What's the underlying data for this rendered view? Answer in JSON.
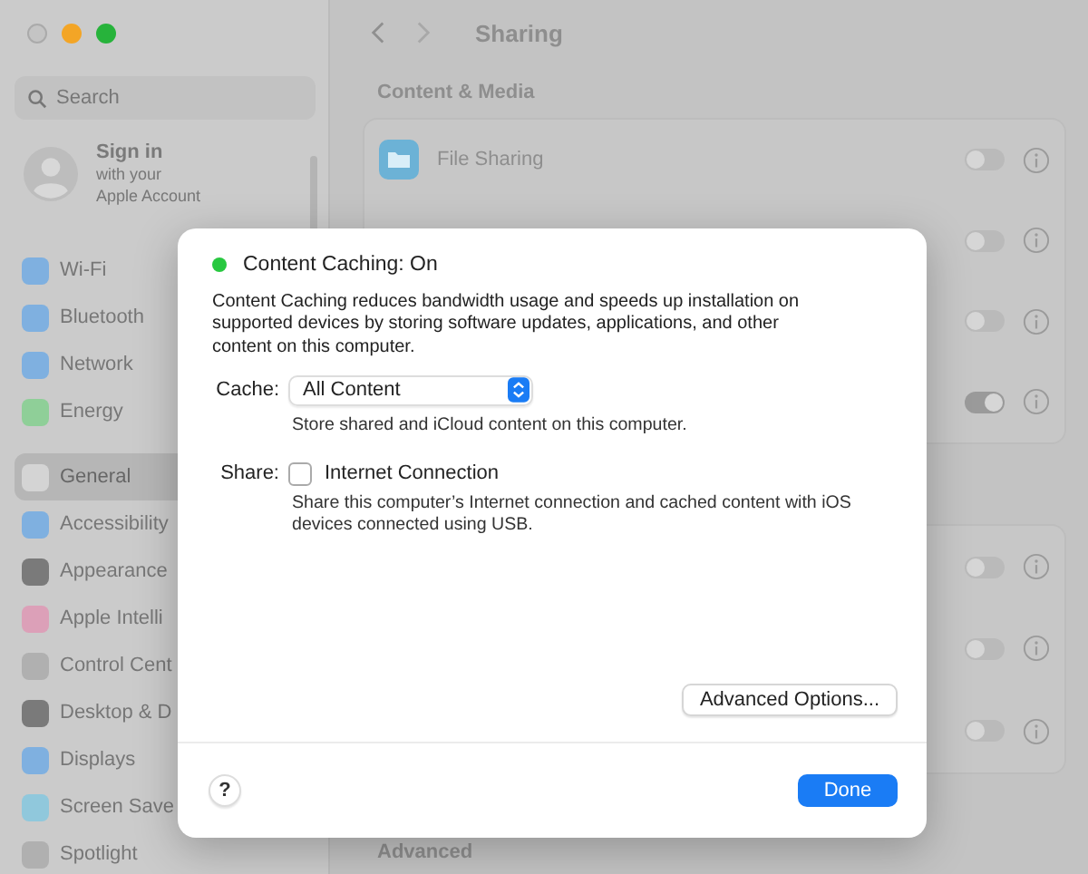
{
  "sidebar": {
    "search": {
      "placeholder": "Search"
    },
    "account": {
      "title": "Sign in",
      "subtitle_lines": [
        "with your",
        "Apple Account"
      ]
    },
    "groups": [
      [
        {
          "label": "Wi-Fi",
          "selected": false,
          "color": "#7fb0e0"
        },
        {
          "label": "Bluetooth",
          "selected": false,
          "color": "#7fb0e0"
        },
        {
          "label": "Network",
          "selected": false,
          "color": "#7fb0e0"
        },
        {
          "label": "Energy",
          "selected": false,
          "color": "#8fcf98"
        }
      ],
      [
        {
          "label": "General",
          "selected": true,
          "color": "#d4d4d4"
        },
        {
          "label": "Accessibility",
          "selected": false,
          "color": "#7fb0e0"
        },
        {
          "label": "Appearance",
          "selected": false,
          "color": "#7a7a7a"
        },
        {
          "label": "Apple Intelli",
          "selected": false,
          "color": "#dca0b8"
        },
        {
          "label": "Control Cent",
          "selected": false,
          "color": "#b0b0b0"
        },
        {
          "label": "Desktop & D",
          "selected": false,
          "color": "#7a7a7a"
        },
        {
          "label": "Displays",
          "selected": false,
          "color": "#7fb0e0"
        },
        {
          "label": "Screen Save",
          "selected": false,
          "color": "#90c8dc"
        },
        {
          "label": "Spotlight",
          "selected": false,
          "color": "#b0b0b0"
        }
      ]
    ]
  },
  "main": {
    "title": "Sharing",
    "section": "Content & Media",
    "cards": [
      {
        "rows": [
          {
            "label": "File Sharing",
            "on": false
          },
          {
            "on": false
          },
          {
            "on": false
          },
          {
            "on": true
          }
        ]
      },
      {
        "rows": [
          {
            "on": false
          },
          {
            "on": false
          },
          {
            "on": false
          }
        ]
      }
    ],
    "footer_section": "Advanced"
  },
  "dialog": {
    "status": {
      "text": "Content Caching: On",
      "color": "#28c840"
    },
    "description": "Content Caching reduces bandwidth usage and speeds up installation on supported devices by storing software updates, applications, and other content on this computer.",
    "cache": {
      "label": "Cache:",
      "value": "All Content",
      "hint": "Store shared and iCloud content on this computer."
    },
    "share": {
      "label": "Share:",
      "option": "Internet Connection",
      "checked": false,
      "hint": "Share this computer’s Internet connection and cached content with iOS devices connected using USB."
    },
    "advanced_button": "Advanced Options...",
    "help_button": "?",
    "done_button": "Done"
  }
}
